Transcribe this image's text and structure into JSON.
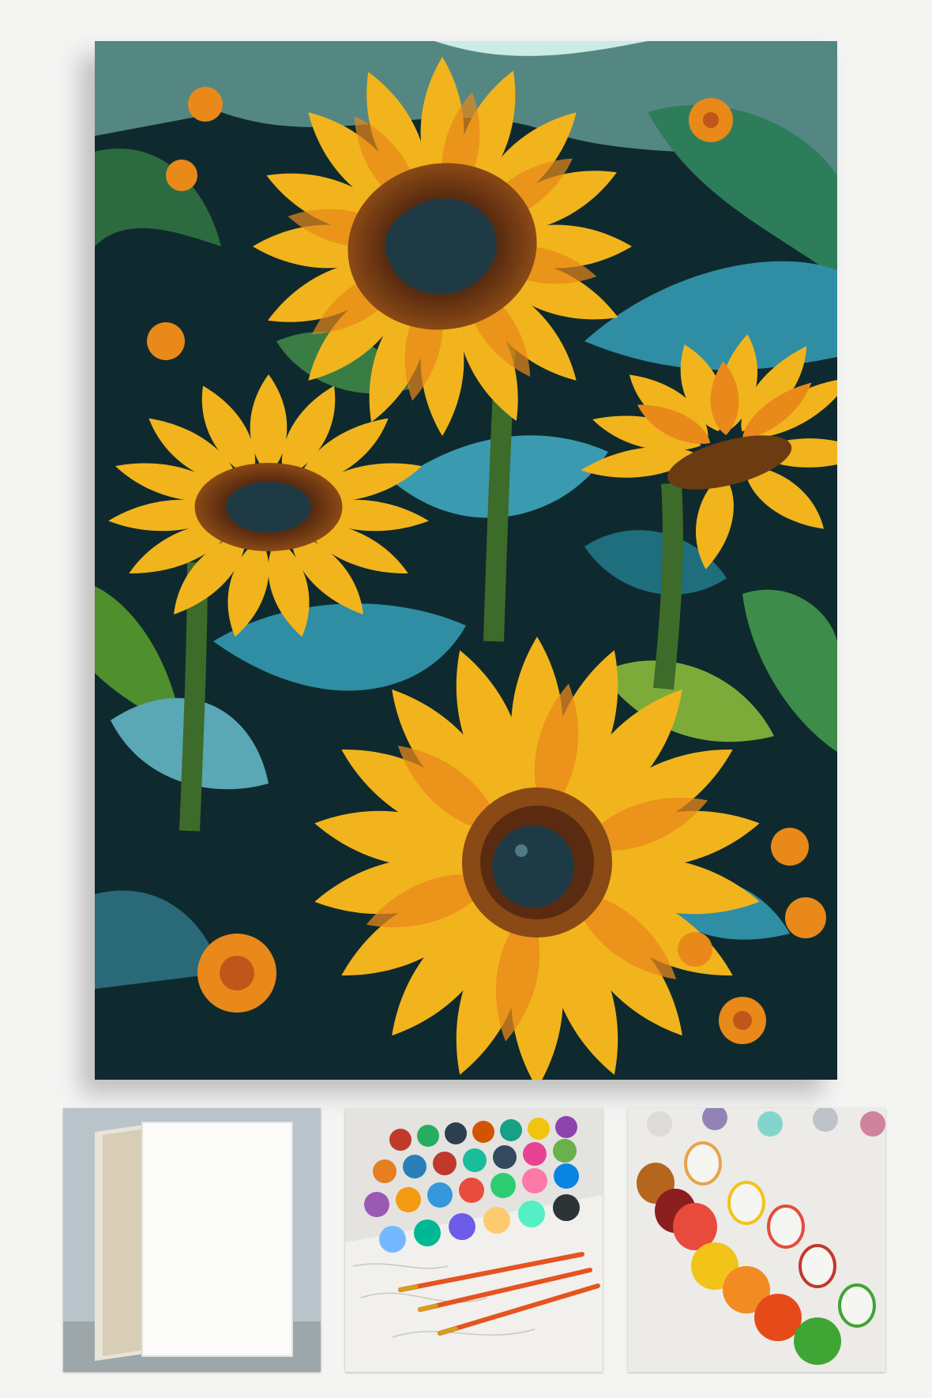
{
  "image": {
    "main_artwork": "sunflower-painting",
    "thumbnails": [
      "blank-canvas",
      "paint-pots-and-brushes",
      "open-paint-pots"
    ]
  },
  "palette": {
    "background": "#f4f4f3",
    "petal_yellow": "#f2b41c",
    "petal_orange": "#e8891a",
    "center_brown": "#5a2b10",
    "center_dark": "#1e3b45",
    "leaf_teal": "#2f8ea3",
    "leaf_green": "#7dab3a",
    "dark_bg": "#0f2a2e",
    "sky_mint": "#8fd3c8"
  }
}
